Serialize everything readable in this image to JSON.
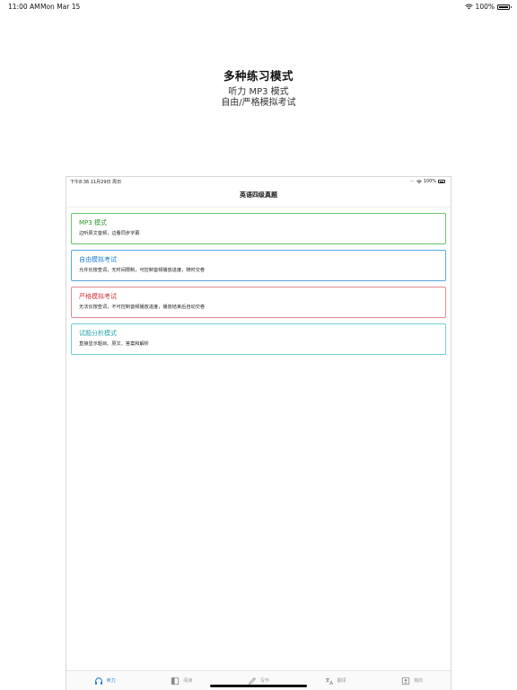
{
  "status_bar": {
    "time": "11:00 AM",
    "date": "Mon Mar 15",
    "battery": "100%"
  },
  "headline": {
    "title": "多种练习模式",
    "line1": "听力 MP3 模式",
    "line2": "自由/严格模拟考试"
  },
  "device": {
    "status": {
      "left": "下午8:36   11月29日 周日",
      "right": "100%"
    },
    "nav_title": "英语四级真题",
    "cards": [
      {
        "title": "MP3 模式",
        "desc": "边听原文音频，边看同步字幕",
        "color": "#2f9a2f"
      },
      {
        "title": "自由模拟考试",
        "desc": "允许长按查词，无时间限制，可控制音频播放进度，随时交卷",
        "color": "#1b7bd0"
      },
      {
        "title": "严格模拟考试",
        "desc": "无法长按查词，不可控制音频播放进度，播放结束后自动交卷",
        "color": "#d0343f"
      },
      {
        "title": "试题分析模式",
        "desc": "直接显示题目、原文、答案和解析",
        "color": "#23a3a8"
      }
    ],
    "tabs": [
      {
        "label": "听力",
        "icon": "headphones-icon",
        "active": true
      },
      {
        "label": "阅读",
        "icon": "book-icon",
        "active": false
      },
      {
        "label": "写作",
        "icon": "pencil-icon",
        "active": false
      },
      {
        "label": "翻译",
        "icon": "translate-icon",
        "active": false
      },
      {
        "label": "我的",
        "icon": "profile-icon",
        "active": false
      }
    ]
  }
}
